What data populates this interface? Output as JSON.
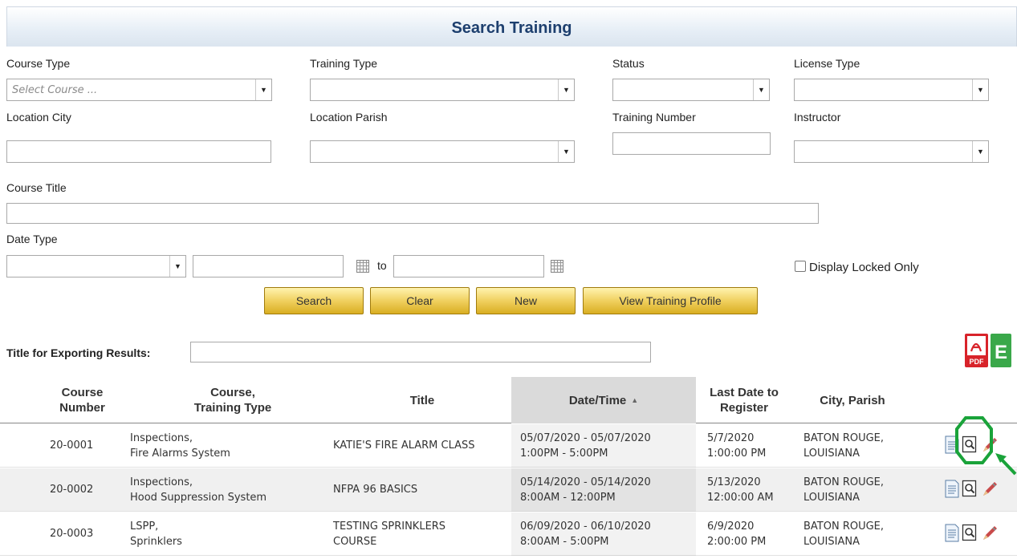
{
  "header": {
    "title": "Search Training"
  },
  "filters": {
    "course_type": {
      "label": "Course Type",
      "placeholder": "Select Course ..."
    },
    "training_type": {
      "label": "Training Type"
    },
    "status": {
      "label": "Status"
    },
    "license_type": {
      "label": "License Type"
    },
    "location_city": {
      "label": "Location City"
    },
    "location_parish": {
      "label": "Location Parish"
    },
    "training_number": {
      "label": "Training Number"
    },
    "instructor": {
      "label": "Instructor"
    },
    "course_title": {
      "label": "Course Title"
    },
    "date_type": {
      "label": "Date Type",
      "to_label": "to"
    },
    "display_locked": {
      "label": "Display Locked Only"
    }
  },
  "buttons": {
    "search": "Search",
    "clear": "Clear",
    "new": "New",
    "view_profile": "View Training Profile"
  },
  "export": {
    "label": "Title for Exporting Results:",
    "pdf_icon": "pdf-icon",
    "excel_icon": "excel-icon"
  },
  "table": {
    "headers": {
      "number_l1": "Course",
      "number_l2": "Number",
      "course_l1": "Course,",
      "course_l2": "Training Type",
      "title": "Title",
      "datetime": "Date/Time",
      "sort_indicator": "▲",
      "lastdate_l1": "Last Date to",
      "lastdate_l2": "Register",
      "cityparish": "City, Parish"
    },
    "rows": [
      {
        "number": "20-0001",
        "course_l1": "Inspections,",
        "course_l2": "Fire Alarms System",
        "title_l1": "KATIE'S FIRE ALARM CLASS",
        "title_l2": "",
        "date_l1": "05/07/2020 - 05/07/2020",
        "date_l2": "1:00PM - 5:00PM",
        "last_l1": "5/7/2020",
        "last_l2": "1:00:00 PM",
        "city_l1": "BATON ROUGE,",
        "city_l2": "LOUISIANA"
      },
      {
        "number": "20-0002",
        "course_l1": "Inspections,",
        "course_l2": "Hood Suppression System",
        "title_l1": "NFPA 96 BASICS",
        "title_l2": "",
        "date_l1": "05/14/2020 - 05/14/2020",
        "date_l2": "8:00AM - 12:00PM",
        "last_l1": "5/13/2020",
        "last_l2": "12:00:00 AM",
        "city_l1": "BATON ROUGE,",
        "city_l2": "LOUISIANA"
      },
      {
        "number": "20-0003",
        "course_l1": "LSPP,",
        "course_l2": "Sprinklers",
        "title_l1": "TESTING SPRINKLERS",
        "title_l2": "COURSE",
        "date_l1": "06/09/2020 - 06/10/2020",
        "date_l2": "8:00AM - 5:00PM",
        "last_l1": "6/9/2020",
        "last_l2": "2:00:00 PM",
        "city_l1": "BATON ROUGE,",
        "city_l2": "LOUISIANA"
      }
    ],
    "row_actions": [
      "document-icon",
      "preview-icon",
      "edit-pencil-icon"
    ]
  },
  "annotation": {
    "highlight_color": "#1aa33a"
  }
}
